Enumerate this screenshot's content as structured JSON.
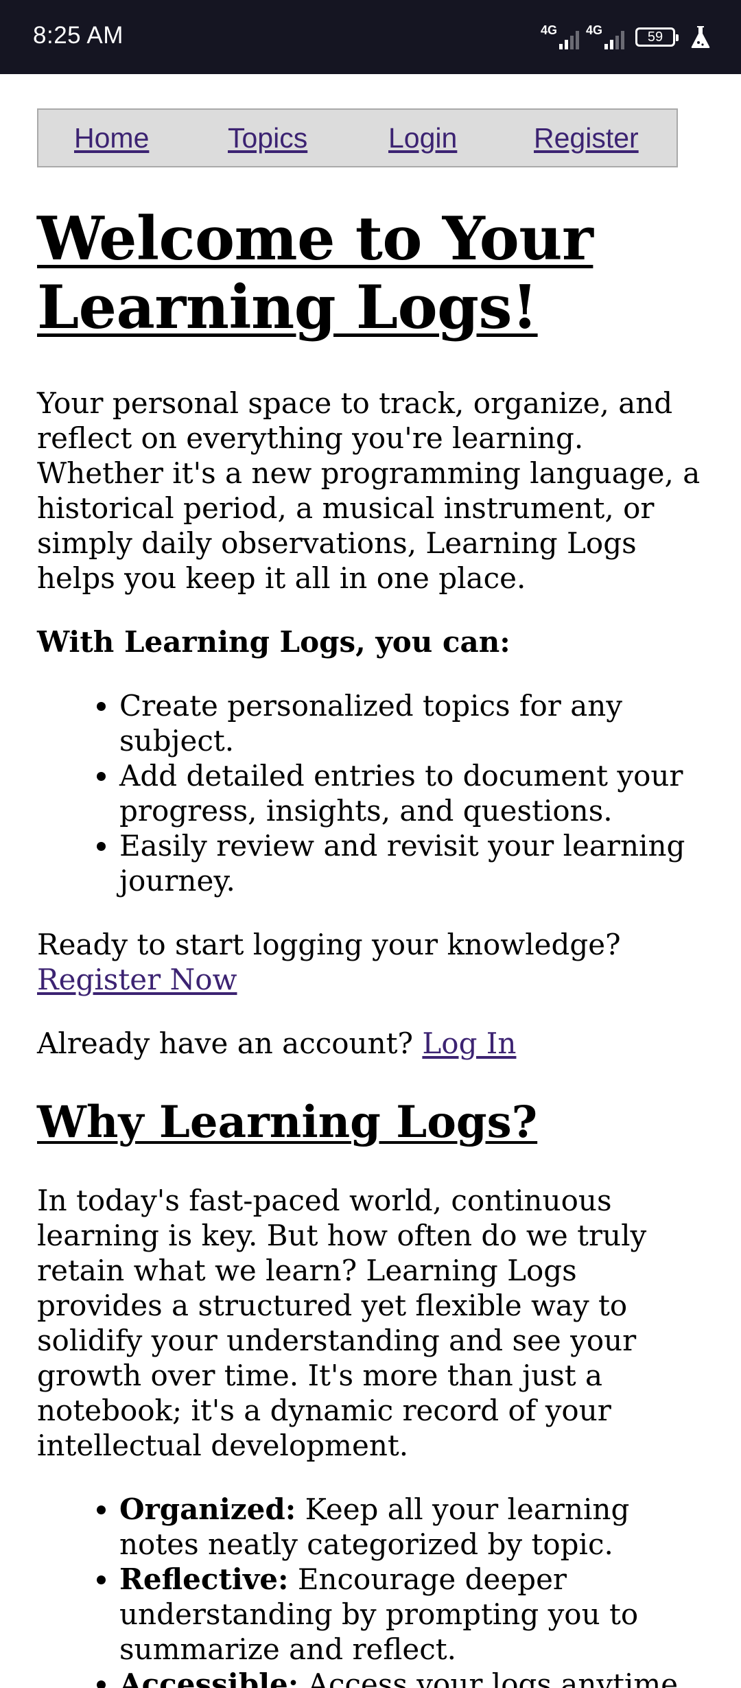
{
  "status_bar": {
    "time": "8:25 AM",
    "signal_1_label": "4G",
    "signal_2_label": "4G",
    "battery_level": "59",
    "icons": [
      "signal-4g-icon",
      "signal-4g-icon",
      "battery-icon",
      "flask-icon"
    ]
  },
  "nav": {
    "items": [
      {
        "label": "Home"
      },
      {
        "label": "Topics"
      },
      {
        "label": "Login"
      },
      {
        "label": "Register"
      }
    ]
  },
  "main": {
    "title": "Welcome to Your Learning Logs!",
    "intro": "Your personal space to track, organize, and reflect on everything you're learning. Whether it's a new programming language, a historical period, a musical instrument, or simply daily observations, Learning Logs helps you keep it all in one place.",
    "features_heading": "With Learning Logs, you can:",
    "features": [
      "Create personalized topics for any subject.",
      "Add detailed entries to document your progress, insights, and questions.",
      "Easily review and revisit your learning journey."
    ],
    "register_prompt": "Ready to start logging your knowledge?",
    "register_link": "Register Now",
    "login_prompt": "Already have an account?",
    "login_link": "Log In"
  },
  "why": {
    "heading": "Why Learning Logs?",
    "body": "In today's fast-paced world, continuous learning is key. But how often do we truly retain what we learn? Learning Logs provides a structured yet flexible way to solidify your understanding and see your growth over time. It's more than just a notebook; it's a dynamic record of your intellectual development.",
    "benefits": [
      {
        "term": "Organized:",
        "desc": "Keep all your learning notes neatly categorized by topic."
      },
      {
        "term": "Reflective:",
        "desc": "Encourage deeper understanding by prompting you to summarize and reflect."
      },
      {
        "term": "Accessible:",
        "desc": "Access your logs anytime, anywhere."
      }
    ]
  },
  "colors": {
    "status_bar_bg": "#151522",
    "nav_bg": "#dcdcdc",
    "link": "#3c2372"
  }
}
